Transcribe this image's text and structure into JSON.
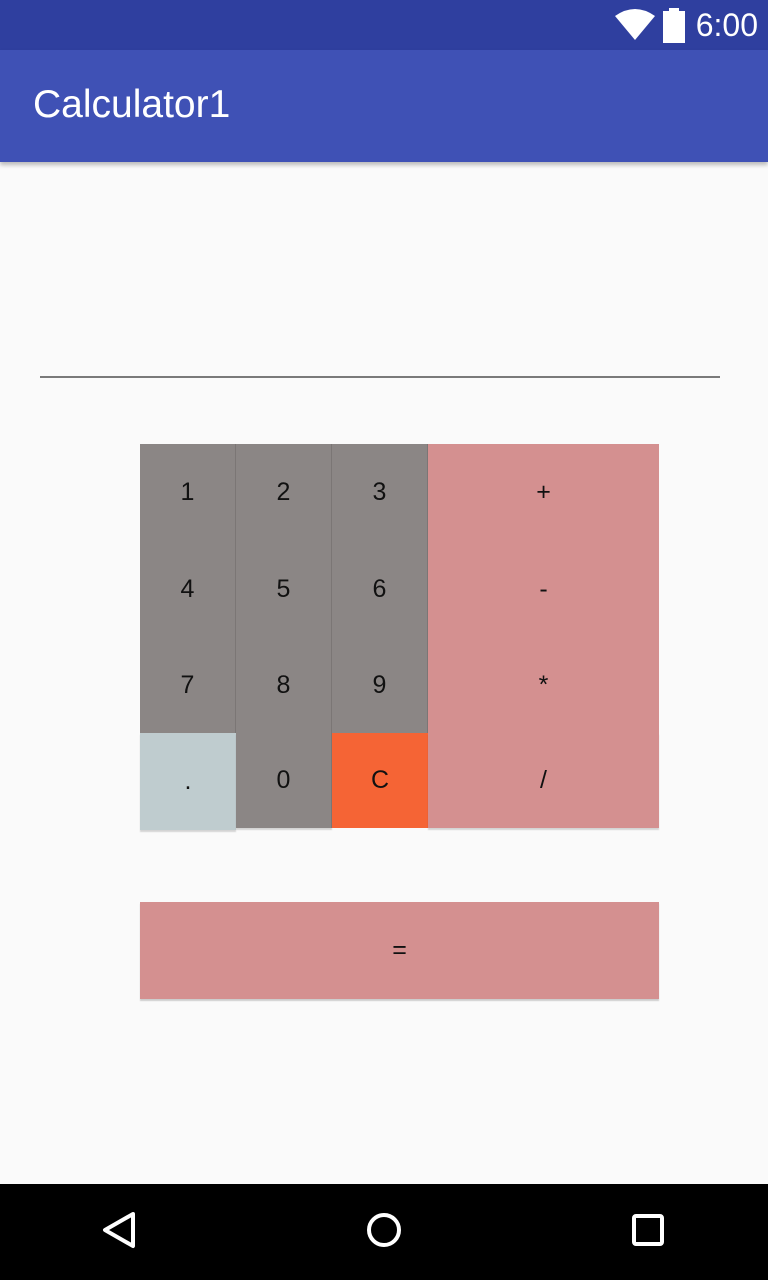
{
  "status_bar": {
    "time": "6:00",
    "icons": [
      "wifi-icon",
      "battery-icon"
    ]
  },
  "app_bar": {
    "title": "Calculator1"
  },
  "display": {
    "value": "",
    "placeholder": ""
  },
  "keypad": {
    "row1": [
      "1",
      "2",
      "3",
      "+"
    ],
    "row2": [
      "4",
      "5",
      "6",
      "-"
    ],
    "row3": [
      "7",
      "8",
      "9",
      "*"
    ],
    "row4": [
      ".",
      "0",
      "C",
      "/"
    ]
  },
  "equals_label": "=",
  "nav_bar": {
    "icons": [
      "back-icon",
      "home-icon",
      "recents-icon"
    ]
  },
  "colors": {
    "status_bar": "#2f3f9f",
    "app_bar": "#3f51b5",
    "number_key": "#8b8685",
    "operator_key": "#d49090",
    "dot_key": "#bfcccf",
    "clear_key": "#f56435",
    "background": "#fafafa"
  }
}
